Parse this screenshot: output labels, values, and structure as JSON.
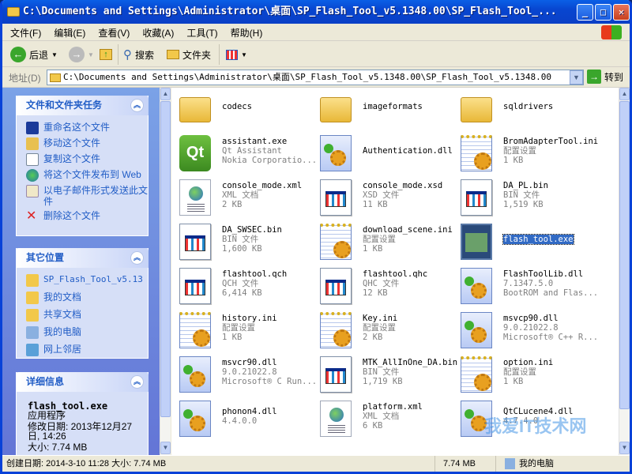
{
  "window": {
    "title": "C:\\Documents and Settings\\Administrator\\桌面\\SP_Flash_Tool_v5.1348.00\\SP_Flash_Tool_...",
    "min": "_",
    "max": "□",
    "close": "✕"
  },
  "menu": [
    "文件(F)",
    "编辑(E)",
    "查看(V)",
    "收藏(A)",
    "工具(T)",
    "帮助(H)"
  ],
  "toolbar": {
    "back": "后退",
    "search": "搜索",
    "folders": "文件夹"
  },
  "address": {
    "label": "地址(D)",
    "value": "C:\\Documents and Settings\\Administrator\\桌面\\SP_Flash_Tool_v5.1348.00\\SP_Flash_Tool_v5.1348.00",
    "go": "转到"
  },
  "tasks": {
    "title": "文件和文件夹任务",
    "items": [
      "重命名这个文件",
      "移动这个文件",
      "复制这个文件",
      "将这个文件发布到 Web",
      "以电子邮件形式发送此文件",
      "删除这个文件"
    ]
  },
  "other_places": {
    "title": "其它位置",
    "items": [
      "SP_Flash_Tool_v5.13",
      "我的文档",
      "共享文档",
      "我的电脑",
      "网上邻居"
    ]
  },
  "details": {
    "title": "详细信息",
    "name": "flash_tool.exe",
    "type": "应用程序",
    "modified": "修改日期: 2013年12月27日, 14:26",
    "size": "大小: 7.74 MB"
  },
  "files": [
    {
      "name": "codecs",
      "kind": "folder"
    },
    {
      "name": "imageformats",
      "kind": "folder"
    },
    {
      "name": "sqldrivers",
      "kind": "folder"
    },
    {
      "name": "assistant.exe",
      "l2": "Qt Assistant",
      "l3": "Nokia Corporatio...",
      "kind": "qt"
    },
    {
      "name": "Authentication.dll",
      "kind": "dll"
    },
    {
      "name": "BromAdapterTool.ini",
      "l2": "配置设置",
      "l3": "1 KB",
      "kind": "ini"
    },
    {
      "name": "console_mode.xml",
      "l2": "XML 文档",
      "l3": "2 KB",
      "kind": "xml"
    },
    {
      "name": "console_mode.xsd",
      "l2": "XSD 文件",
      "l3": "11 KB",
      "kind": "doc"
    },
    {
      "name": "DA_PL.bin",
      "l2": "BIN 文件",
      "l3": "1,519 KB",
      "kind": "doc"
    },
    {
      "name": "DA_SWSEC.bin",
      "l2": "BIN 文件",
      "l3": "1,600 KB",
      "kind": "doc"
    },
    {
      "name": "download_scene.ini",
      "l2": "配置设置",
      "l3": "1 KB",
      "kind": "ini"
    },
    {
      "name": "flash_tool.exe",
      "kind": "android",
      "selected": true
    },
    {
      "name": "flashtool.qch",
      "l2": "QCH 文件",
      "l3": "6,414 KB",
      "kind": "doc"
    },
    {
      "name": "flashtool.qhc",
      "l2": "QHC 文件",
      "l3": "12 KB",
      "kind": "doc"
    },
    {
      "name": "FlashToolLib.dll",
      "l2": "7.1347.5.0",
      "l3": "BootROM and Flas...",
      "kind": "dll"
    },
    {
      "name": "history.ini",
      "l2": "配置设置",
      "l3": "1 KB",
      "kind": "ini"
    },
    {
      "name": "Key.ini",
      "l2": "配置设置",
      "l3": "2 KB",
      "kind": "ini"
    },
    {
      "name": "msvcp90.dll",
      "l2": "9.0.21022.8",
      "l3": "Microsoft® C++ R...",
      "kind": "dll"
    },
    {
      "name": "msvcr90.dll",
      "l2": "9.0.21022.8",
      "l3": "Microsoft® C Run...",
      "kind": "dll"
    },
    {
      "name": "MTK_AllInOne_DA.bin",
      "l2": "BIN 文件",
      "l3": "1,719 KB",
      "kind": "doc"
    },
    {
      "name": "option.ini",
      "l2": "配置设置",
      "l3": "1 KB",
      "kind": "ini"
    },
    {
      "name": "phonon4.dll",
      "l2": "4.4.0.0",
      "kind": "dll"
    },
    {
      "name": "platform.xml",
      "l2": "XML 文档",
      "l3": "6 KB",
      "kind": "xml"
    },
    {
      "name": "QtCLucene4.dll",
      "l2": "4.7.4.0",
      "kind": "dll"
    }
  ],
  "status": {
    "info": "创建日期: 2014-3-10 11:28 大小: 7.74 MB",
    "size": "7.74 MB",
    "zone": "我的电脑"
  },
  "watermark": "我爱IT技术网"
}
